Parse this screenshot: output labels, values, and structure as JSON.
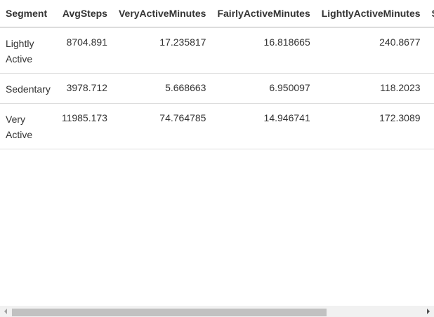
{
  "table": {
    "columns": [
      "Segment",
      "AvgSteps",
      "VeryActiveMinutes",
      "FairlyActiveMinutes",
      "LightlyActiveMinutes",
      "S"
    ],
    "rows": [
      {
        "segment": "Lightly Active",
        "avg_steps": "8704.891",
        "very_active": "17.235817",
        "fairly_active": "16.818665",
        "lightly_active": "240.8677",
        "partial": ""
      },
      {
        "segment": "Sedentary",
        "avg_steps": "3978.712",
        "very_active": "5.668663",
        "fairly_active": "6.950097",
        "lightly_active": "118.2023",
        "partial": ""
      },
      {
        "segment": "Very Active",
        "avg_steps": "11985.173",
        "very_active": "74.764785",
        "fairly_active": "14.946741",
        "lightly_active": "172.3089",
        "partial": ""
      }
    ]
  },
  "scrollbar": {
    "left_arrow_icon": "chevron-left-icon",
    "right_arrow_icon": "chevron-right-icon",
    "position": 0
  }
}
